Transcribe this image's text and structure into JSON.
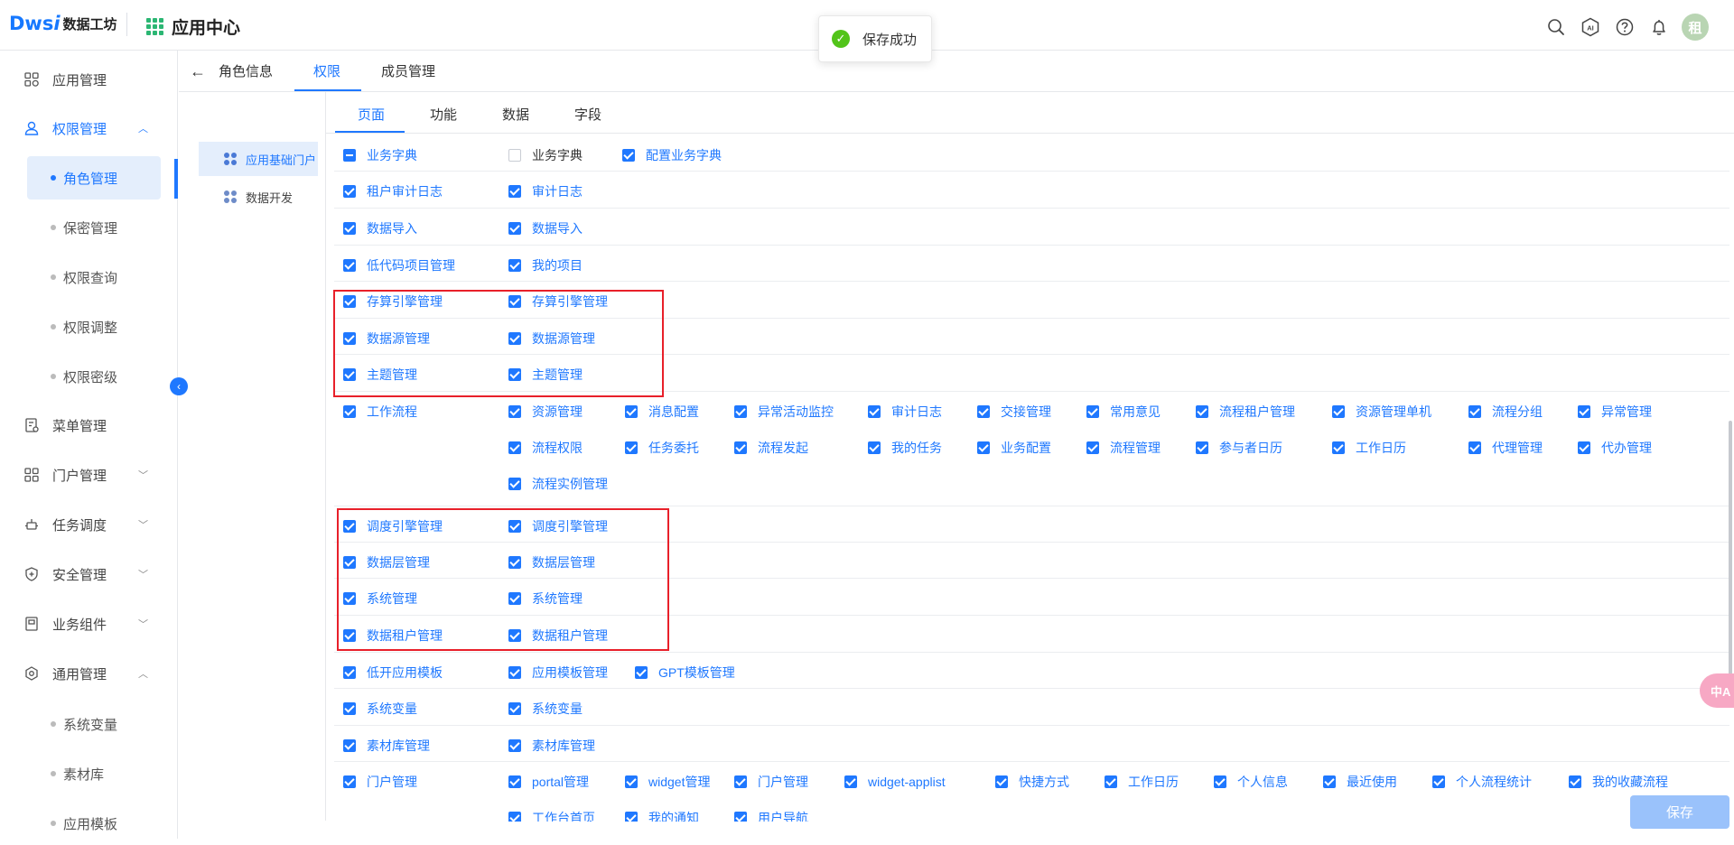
{
  "header": {
    "logo_mark": "Dws",
    "logo_i": "i",
    "logo_text": "数据工坊",
    "app_center": "应用中心",
    "avatar_text": "租",
    "icons": [
      "search-icon",
      "ai-icon",
      "help-icon",
      "bell-icon"
    ]
  },
  "toast": {
    "text": "保存成功"
  },
  "sidebar": {
    "items": [
      {
        "label": "应用管理",
        "icon": "apps-icon"
      },
      {
        "label": "权限管理",
        "icon": "user-icon",
        "chevron": "︿"
      },
      {
        "label": "菜单管理",
        "icon": "menu-icon"
      },
      {
        "label": "门户管理",
        "icon": "portal-icon",
        "chevron": "﹀"
      },
      {
        "label": "任务调度",
        "icon": "task-icon",
        "chevron": "﹀"
      },
      {
        "label": "安全管理",
        "icon": "shield-icon",
        "chevron": "﹀"
      },
      {
        "label": "业务组件",
        "icon": "component-icon",
        "chevron": "﹀"
      },
      {
        "label": "通用管理",
        "icon": "settings-icon",
        "chevron": "︿"
      }
    ],
    "perm_sub": [
      "角色管理",
      "保密管理",
      "权限查询",
      "权限调整",
      "权限密级"
    ],
    "common_sub": [
      "系统变量",
      "素材库",
      "应用模板"
    ]
  },
  "tabs": {
    "back": "←",
    "items": [
      "角色信息",
      "权限",
      "成员管理"
    ]
  },
  "tree": [
    "应用基础门户",
    "数据开发"
  ],
  "sub_tabs": [
    "页面",
    "功能",
    "数据",
    "字段"
  ],
  "rows": [
    {
      "main": "业务字典",
      "main_state": "indet",
      "children": [
        {
          "label": "业务字典",
          "state": "off"
        },
        {
          "label": "配置业务字典"
        }
      ]
    },
    {
      "main": "租户审计日志",
      "children": [
        {
          "label": "审计日志"
        }
      ]
    },
    {
      "main": "数据导入",
      "children": [
        {
          "label": "数据导入"
        }
      ]
    },
    {
      "main": "低代码项目管理",
      "children": [
        {
          "label": "我的项目"
        }
      ]
    },
    {
      "main": "存算引擎管理",
      "children": [
        {
          "label": "存算引擎管理"
        }
      ]
    },
    {
      "main": "数据源管理",
      "children": [
        {
          "label": "数据源管理"
        }
      ]
    },
    {
      "main": "主题管理",
      "children": [
        {
          "label": "主题管理"
        }
      ]
    },
    {
      "main": "工作流程",
      "lines": [
        [
          "资源管理",
          "消息配置",
          "异常活动监控",
          "审计日志",
          "交接管理",
          "常用意见",
          "流程租户管理",
          "资源管理单机",
          "流程分组",
          "异常管理"
        ],
        [
          "流程权限",
          "任务委托",
          "流程发起",
          "我的任务",
          "业务配置",
          "流程管理",
          "参与者日历",
          "工作日历",
          "代理管理",
          "代办管理"
        ],
        [
          "流程实例管理"
        ]
      ]
    },
    {
      "main": "调度引擎管理",
      "children": [
        {
          "label": "调度引擎管理"
        }
      ]
    },
    {
      "main": "数据层管理",
      "children": [
        {
          "label": "数据层管理"
        }
      ]
    },
    {
      "main": "系统管理",
      "children": [
        {
          "label": "系统管理"
        }
      ]
    },
    {
      "main": "数据租户管理",
      "children": [
        {
          "label": "数据租户管理"
        }
      ]
    },
    {
      "main": "低开应用模板",
      "children": [
        {
          "label": "应用模板管理"
        },
        {
          "label": "GPT模板管理"
        }
      ]
    },
    {
      "main": "系统变量",
      "children": [
        {
          "label": "系统变量"
        }
      ]
    },
    {
      "main": "素材库管理",
      "children": [
        {
          "label": "素材库管理"
        }
      ]
    },
    {
      "main": "门户管理",
      "lines": [
        [
          "portal管理",
          "widget管理",
          "门户管理",
          "widget-applist",
          "快捷方式",
          "工作日历",
          "个人信息",
          "最近使用",
          "个人流程统计",
          "我的收藏流程"
        ],
        [
          "工作台首页",
          "我的通知",
          "用户导航"
        ]
      ]
    }
  ],
  "float_pill": "中A",
  "save_button": "保存",
  "colors": {
    "primary": "#1f78ff",
    "highlight_box": "#e8202a",
    "success": "#52c41a"
  }
}
